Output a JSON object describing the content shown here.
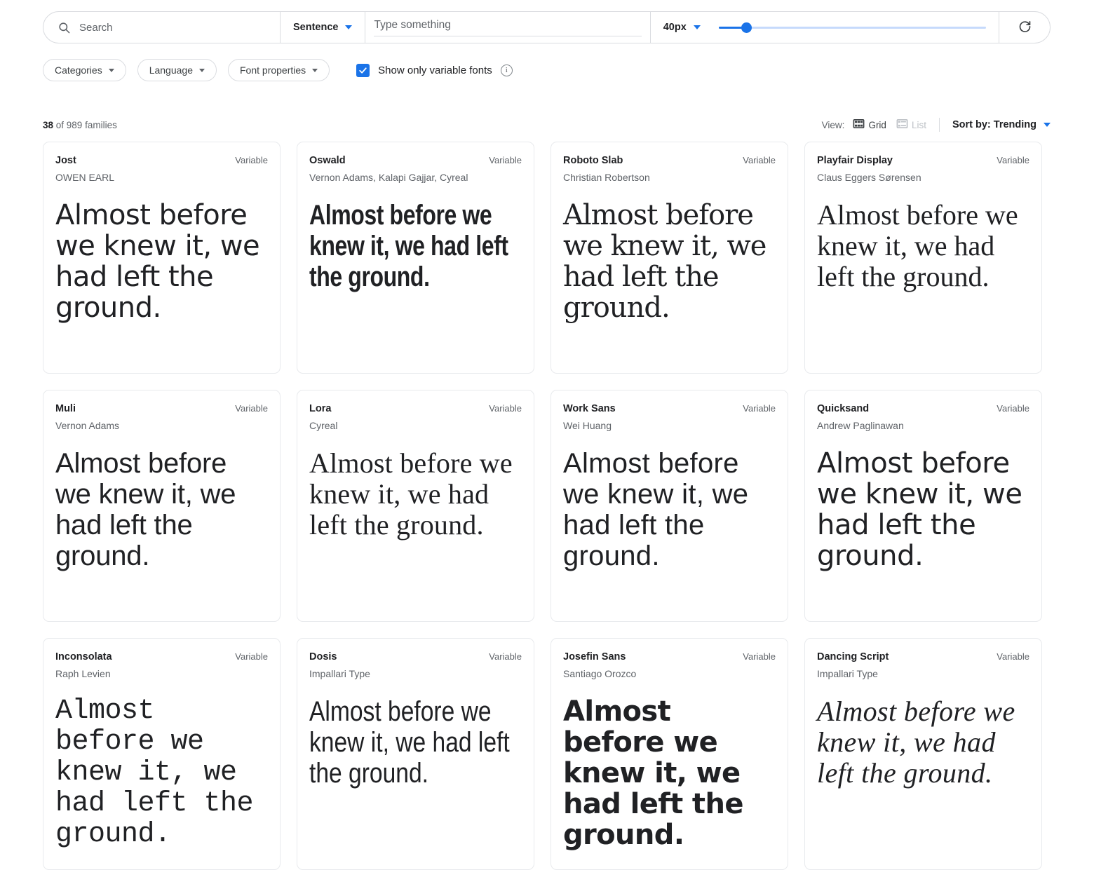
{
  "toolbar": {
    "search_placeholder": "Search",
    "search_value": "",
    "preview_mode": "Sentence",
    "type_placeholder": "Type something",
    "type_value": "",
    "font_size": "40px",
    "slider_percent": 10.5,
    "refresh_icon": "refresh-icon",
    "search_icon": "search-icon"
  },
  "filters": {
    "chips": [
      {
        "label": "Categories"
      },
      {
        "label": "Language"
      },
      {
        "label": "Font properties"
      }
    ],
    "variable_fonts": {
      "label": "Show only variable fonts",
      "checked": true,
      "accent": "#1a73e8",
      "info_icon": "info-icon",
      "info_glyph": "i"
    }
  },
  "results": {
    "count": "38",
    "count_suffix": " of 989 families",
    "view_label": "View:",
    "view_grid": "Grid",
    "view_list": "List",
    "active_view": "Grid",
    "sort_label": "Sort by: Trending"
  },
  "fonts": [
    {
      "name": "Jost",
      "designer": "OWEN EARL",
      "badge": "Variable",
      "sample": "Almost before we knew it, we had left the ground.",
      "style": "f-jost"
    },
    {
      "name": "Oswald",
      "designer": "Vernon Adams, Kalapi Gajjar, Cyreal",
      "badge": "Variable",
      "sample": "Almost before we knew it, we had left the ground.",
      "style": "f-oswald"
    },
    {
      "name": "Roboto Slab",
      "designer": "Christian Robertson",
      "badge": "Variable",
      "sample": "Almost before we knew it, we had left the ground.",
      "style": "f-robotoslab"
    },
    {
      "name": "Playfair Display",
      "designer": "Claus Eggers Sørensen",
      "badge": "Variable",
      "sample": "Almost before we knew it, we had left the ground.",
      "style": "f-playfair"
    },
    {
      "name": "Muli",
      "designer": "Vernon Adams",
      "badge": "Variable",
      "sample": "Almost before we knew it, we had left the ground.",
      "style": "f-muli"
    },
    {
      "name": "Lora",
      "designer": "Cyreal",
      "badge": "Variable",
      "sample": "Almost before we knew it, we had left the ground.",
      "style": "f-lora"
    },
    {
      "name": "Work Sans",
      "designer": "Wei Huang",
      "badge": "Variable",
      "sample": "Almost before we knew it, we had left the ground.",
      "style": "f-worksans"
    },
    {
      "name": "Quicksand",
      "designer": "Andrew Paglinawan",
      "badge": "Variable",
      "sample": "Almost before we knew it, we had left the ground.",
      "style": "f-quicksand"
    },
    {
      "name": "Inconsolata",
      "designer": "Raph Levien",
      "badge": "Variable",
      "sample": "Almost before we knew it, we had left the ground.",
      "style": "f-inconsolata"
    },
    {
      "name": "Dosis",
      "designer": "Impallari Type",
      "badge": "Variable",
      "sample": "Almost before we knew it, we had left the ground.",
      "style": "f-dosis"
    },
    {
      "name": "Josefin Sans",
      "designer": "Santiago Orozco",
      "badge": "Variable",
      "sample": "Almost before we knew it, we had left the ground.",
      "style": "f-josefin"
    },
    {
      "name": "Dancing Script",
      "designer": "Impallari Type",
      "badge": "Variable",
      "sample": "Almost before we knew it, we had left the ground.",
      "style": "f-dancing"
    }
  ]
}
